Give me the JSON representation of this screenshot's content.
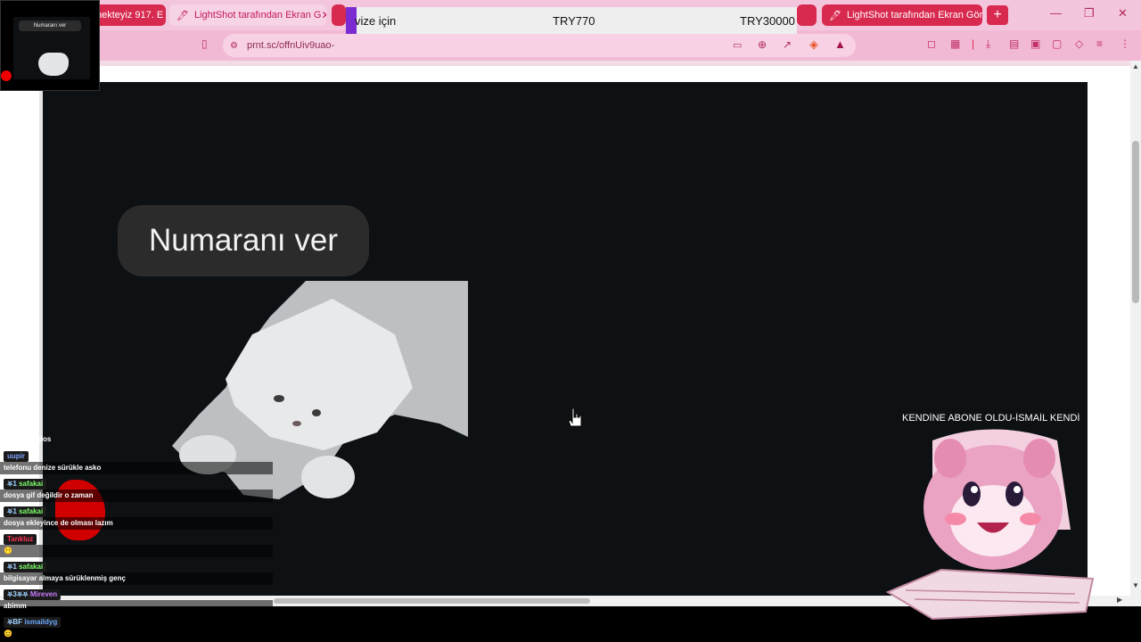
{
  "browser": {
    "tabs": [
      {
        "label": "nekteyiz 917. E",
        "active": false
      },
      {
        "label": "LightShot tarafından Ekran G",
        "active": true
      },
      {
        "label": "LightShot tarafından Ekran Görü",
        "active": false
      }
    ],
    "url": "prnt.sc/offnUiv9uao-",
    "window_controls": [
      "minimize",
      "restore",
      "close"
    ]
  },
  "ticker": {
    "text_left": "vize için",
    "price_1": "TRY770",
    "price_2": "TRY30000"
  },
  "webcam": {
    "label": "Numaranı ver"
  },
  "screenshot": {
    "bubble_text": "Numaranı ver"
  },
  "chat": {
    "top_line": "fkeegskdkdos",
    "messages": [
      {
        "user": "uupir",
        "user_color": "#7fa7ff",
        "badges": "",
        "text": "telefonu denize sürükle asko"
      },
      {
        "user": "safakai",
        "user_color": "#7dff6a",
        "badges": "⛧1",
        "text": "dosya gif değildir o zaman"
      },
      {
        "user": "safakai",
        "user_color": "#7dff6a",
        "badges": "⛧1",
        "text": "dosya ekleyince de olması lazım"
      },
      {
        "user": "Tankluz",
        "user_color": "#ff3355",
        "badges": "",
        "text": "😶"
      },
      {
        "user": "safakai",
        "user_color": "#7dff6a",
        "badges": "⛧1",
        "text": "bilgisayar almaya sürüklenmiş genç"
      },
      {
        "user": "Mireven",
        "user_color": "#c77dff",
        "badges": "⛧3⛧⛧",
        "text": "abimm"
      },
      {
        "user": "ismaildyg",
        "user_color": "#6aa9ff",
        "badges": "⛧BF",
        "text": "😊"
      }
    ]
  },
  "alert": {
    "text": "KENDİNE ABONE OLDU-İSMAİL KENDİ"
  },
  "colors": {
    "tab_red": "#d8294f",
    "chrome_pink": "#f4c6dd",
    "ticker_accent": "#7a2bd1",
    "shot_bg": "#0d1114"
  },
  "icons": [
    "shield-icon",
    "zoom-icon",
    "share-icon",
    "cast-icon",
    "brave-icon",
    "bat-triangle-icon",
    "hand-cursor-icon"
  ]
}
